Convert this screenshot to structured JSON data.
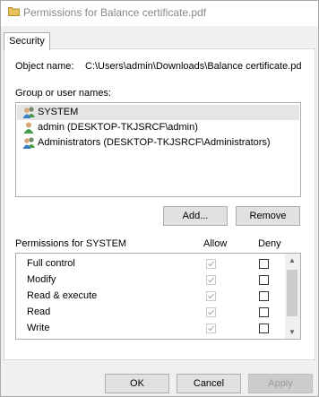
{
  "window": {
    "title": "Permissions for Balance certificate.pdf"
  },
  "tabs": [
    {
      "label": "Security"
    }
  ],
  "security": {
    "object_name_label": "Object name:",
    "object_name_value": "C:\\Users\\admin\\Downloads\\Balance certificate.pd",
    "group_label": "Group or user names:",
    "users": [
      {
        "name": "SYSTEM",
        "icon": "users-group-icon",
        "selected": true
      },
      {
        "name": "admin (DESKTOP-TKJSRCF\\admin)",
        "icon": "user-icon",
        "selected": false
      },
      {
        "name": "Administrators (DESKTOP-TKJSRCF\\Administrators)",
        "icon": "users-group-icon",
        "selected": false
      }
    ],
    "add_button": "Add...",
    "remove_button": "Remove",
    "permissions_label": "Permissions for SYSTEM",
    "allow_header": "Allow",
    "deny_header": "Deny",
    "permissions": [
      {
        "name": "Full control",
        "allow": true,
        "deny": false
      },
      {
        "name": "Modify",
        "allow": true,
        "deny": false
      },
      {
        "name": "Read & execute",
        "allow": true,
        "deny": false
      },
      {
        "name": "Read",
        "allow": true,
        "deny": false
      },
      {
        "name": "Write",
        "allow": true,
        "deny": false
      }
    ]
  },
  "footer": {
    "ok_button": "OK",
    "cancel_button": "Cancel",
    "apply_button": "Apply"
  },
  "colors": {
    "selection": "#e5e5e5",
    "button_face": "#e1e1e1",
    "disabled_text": "#9a9a9a"
  }
}
